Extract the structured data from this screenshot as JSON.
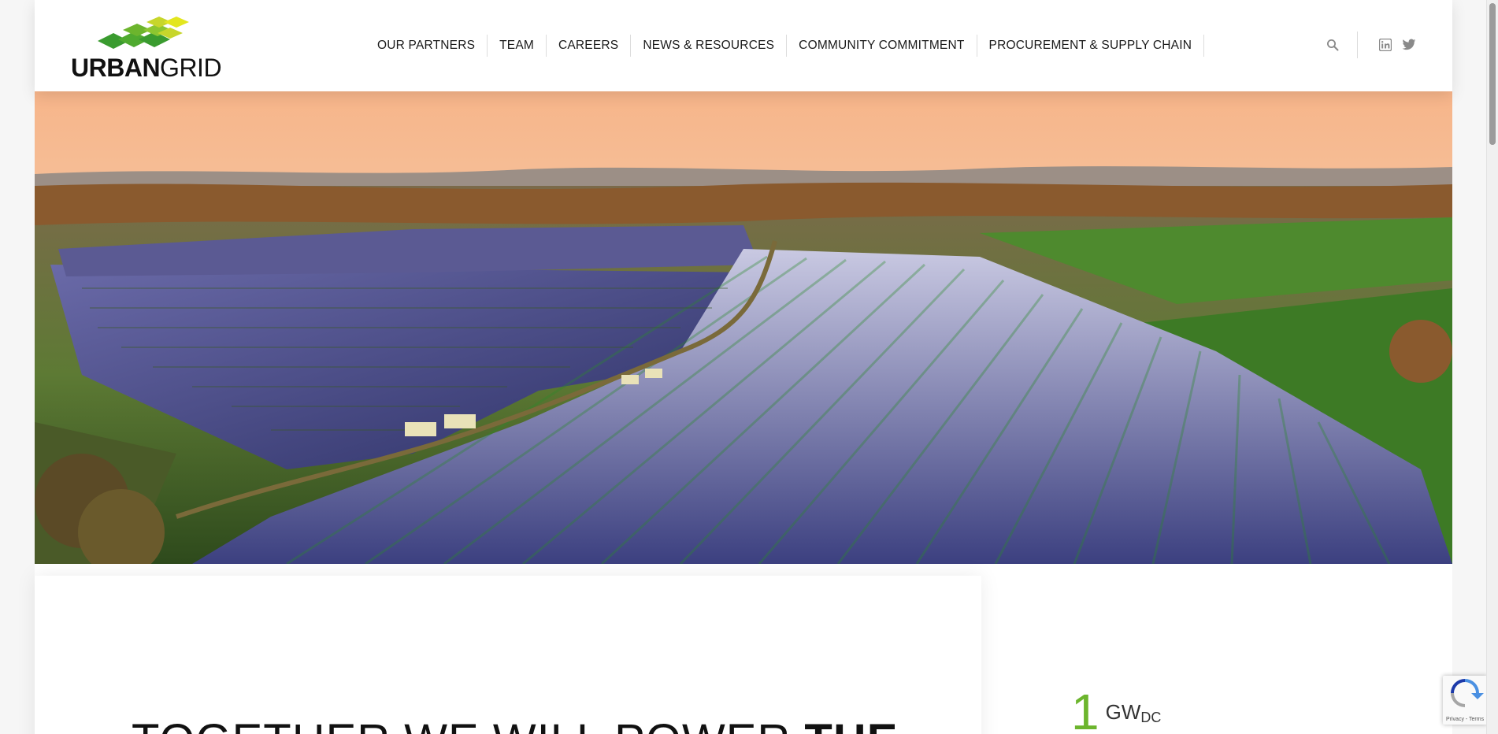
{
  "header": {
    "logo": {
      "name": "urban-grid-logo",
      "text_bold": "URBAN",
      "text_light": "GRID",
      "colors": [
        "#3a9b2f",
        "#6cb52d",
        "#c7d62b",
        "#e3e61f"
      ]
    },
    "nav": [
      {
        "label": "OUR PARTNERS"
      },
      {
        "label": "TEAM"
      },
      {
        "label": "CAREERS"
      },
      {
        "label": "NEWS & RESOURCES"
      },
      {
        "label": "COMMUNITY COMMITMENT"
      },
      {
        "label": "PROCUREMENT & SUPPLY CHAIN"
      }
    ],
    "utilities": {
      "search_icon": "search-icon",
      "social": [
        {
          "icon": "linkedin-icon"
        },
        {
          "icon": "twitter-icon"
        }
      ]
    }
  },
  "hero": {
    "image": "aerial solar farm at sunset"
  },
  "content": {
    "headline_light": "TOGETHER WE WILL POWER ",
    "headline_strong": "THE"
  },
  "stat": {
    "number": "1",
    "unit": "GW",
    "unit_sub": "DC"
  },
  "recaptcha": {
    "links": "Privacy - Terms"
  },
  "colors": {
    "accent_green": "#6cb52d",
    "text": "#111111"
  }
}
